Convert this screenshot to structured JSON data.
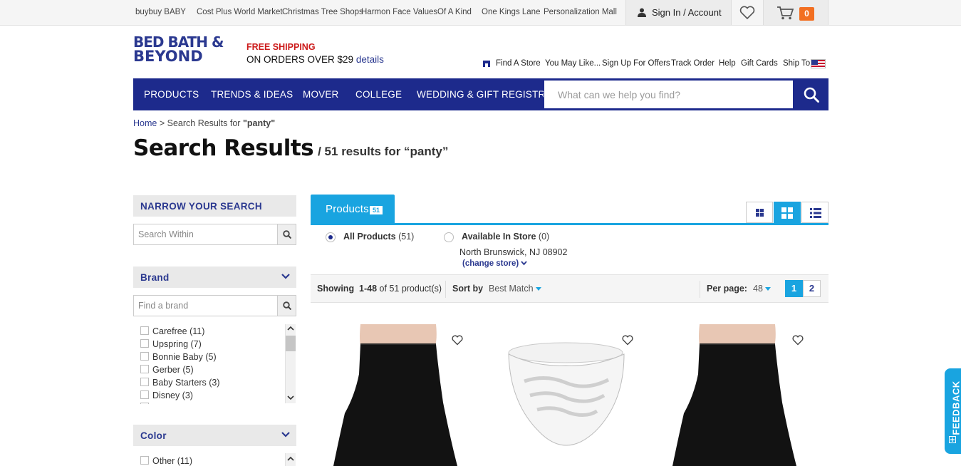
{
  "sister_sites": [
    "buybuy BABY",
    "Cost Plus World Market",
    "Christmas Tree Shops",
    "Harmon Face Values",
    "Of A Kind",
    "One Kings Lane",
    "Personalization Mall"
  ],
  "account": {
    "sign_in": "Sign In / Account",
    "cart_count": "0"
  },
  "logo": {
    "line1": "BED BATH &",
    "line2": "BEYOND"
  },
  "shipping": {
    "line1": "FREE SHIPPING",
    "line2": "ON ORDERS OVER $29",
    "details": "details"
  },
  "util_nav": [
    "Find A Store",
    "You May Like...",
    "Sign Up For Offers",
    "Track Order",
    "Help",
    "Gift Cards",
    "Ship To"
  ],
  "main_nav": [
    "PRODUCTS",
    "TRENDS & IDEAS",
    "MOVER",
    "COLLEGE",
    "WEDDING & GIFT REGISTRY"
  ],
  "search": {
    "placeholder": "What can we help you find?"
  },
  "breadcrumb": {
    "home": "Home",
    "sep": ">",
    "prefix": "Search Results for",
    "term": "\"panty\""
  },
  "title": {
    "main": "Search Results",
    "sub": "/ 51 results for “panty”"
  },
  "narrow": {
    "heading": "NARROW YOUR SEARCH",
    "within_placeholder": "Search Within",
    "brand_heading": "Brand",
    "brand_placeholder": "Find a brand",
    "brands": [
      "Carefree (11)",
      "Upspring (7)",
      "Bonnie Baby (5)",
      "Gerber (5)",
      "Baby Starters (3)",
      "Disney (3)"
    ],
    "color_heading": "Color",
    "colors": [
      "Other (11)"
    ]
  },
  "tabs": {
    "products_label": "Products",
    "products_count": "51"
  },
  "availability": {
    "all_label": "All Products",
    "all_count": "(51)",
    "store_label": "Available In Store",
    "store_count": "(0)",
    "store_location": "North Brunswick, NJ 08902",
    "change_store": "(change store)"
  },
  "sortbar": {
    "showing_label": "Showing",
    "showing_range": "1-48",
    "showing_of": "of 51 product(s)",
    "sort_label": "Sort by",
    "sort_value": "Best Match",
    "per_page_label": "Per page:",
    "per_page_value": "48",
    "pages": [
      "1",
      "2"
    ]
  },
  "products": [
    {
      "name": "black-shapewear-brief-image"
    },
    {
      "name": "white-ruffle-diaper-cover-image"
    },
    {
      "name": "black-shapewear-brief-image"
    }
  ],
  "feedback": "FEEDBACK",
  "colors": {
    "brand_blue": "#1d2a8c",
    "accent": "#19a4e0",
    "cart_badge": "#f26f21",
    "shipping_red": "#cc1a1a"
  }
}
